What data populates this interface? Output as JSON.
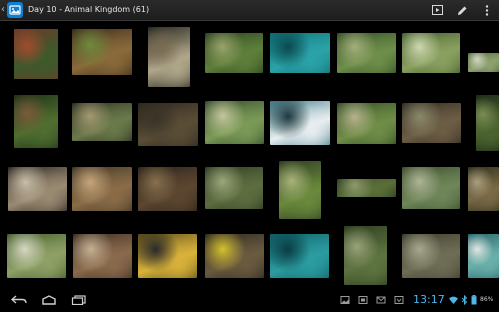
{
  "action_bar": {
    "title": "Day 10 - Animal Kingdom (61)",
    "app_icon": "gallery-app-icon",
    "back_icon": "up-caret-icon",
    "actions": [
      "slideshow-icon",
      "edit-pencil-icon",
      "overflow-menu-icon"
    ]
  },
  "photos": {
    "count_label": "61",
    "thumbnails": [
      {
        "label": "red-rock-tree",
        "colors": [
          "#6b3b2a",
          "#3d5a2b",
          "#a24b2e"
        ]
      },
      {
        "label": "tortoise-in-hollow",
        "colors": [
          "#3a2a1a",
          "#8a6a3a",
          "#6f8a3d"
        ]
      },
      {
        "label": "branch-with-animal",
        "colors": [
          "#2a2a22",
          "#b0a78a",
          "#7a6a52"
        ]
      },
      {
        "label": "jungle-rocks",
        "colors": [
          "#28401e",
          "#5e7f3a",
          "#9aa36a"
        ]
      },
      {
        "label": "fish-aquarium",
        "colors": [
          "#0f6f74",
          "#2aa3a8",
          "#0a4a4f"
        ]
      },
      {
        "label": "forest-grove",
        "colors": [
          "#2e4a20",
          "#6e8e4a",
          "#a3b07c"
        ]
      },
      {
        "label": "savanna-trees",
        "colors": [
          "#3f5a2a",
          "#8aa060",
          "#cfd8b0"
        ]
      },
      {
        "label": "savanna-path",
        "colors": [
          "#4c6a33",
          "#8ea170",
          "#d3d6c6"
        ]
      },
      {
        "label": "jungle-trunk",
        "colors": [
          "#1f3219",
          "#4f6e2f",
          "#7b5a3a"
        ]
      },
      {
        "label": "lizard-on-log",
        "colors": [
          "#2a2a1f",
          "#6a7a4a",
          "#a39a70"
        ]
      },
      {
        "label": "boulder-closeup",
        "colors": [
          "#2b261d",
          "#5a4d36",
          "#3a3428"
        ]
      },
      {
        "label": "lily-pads",
        "colors": [
          "#30482a",
          "#7b9a56",
          "#c4c79c"
        ]
      },
      {
        "label": "swan-on-water",
        "colors": [
          "#3f7c88",
          "#e8eef0",
          "#1e3a40"
        ]
      },
      {
        "label": "garden-path",
        "colors": [
          "#2f4b22",
          "#6f8d47",
          "#b7b28c"
        ]
      },
      {
        "label": "root-stump",
        "colors": [
          "#2f2a20",
          "#6c5d45",
          "#8c8a6a"
        ]
      },
      {
        "label": "dense-bamboo",
        "colors": [
          "#1e2c18",
          "#4c6430",
          "#7c8d54"
        ]
      },
      {
        "label": "figurines",
        "colors": [
          "#2a2520",
          "#9a8a72",
          "#c8bfa8"
        ]
      },
      {
        "label": "iguana-on-stump",
        "colors": [
          "#3d3322",
          "#8a6c48",
          "#c6a67c"
        ]
      },
      {
        "label": "tree-bark",
        "colors": [
          "#2a2219",
          "#5b4630",
          "#87704e"
        ]
      },
      {
        "label": "gorilla-tree",
        "colors": [
          "#2e3a22",
          "#5e6d40",
          "#9aa77a"
        ]
      },
      {
        "label": "fern-branch",
        "colors": [
          "#2f3d22",
          "#6a8a3c",
          "#a9b27a"
        ]
      },
      {
        "label": "big-tree",
        "colors": [
          "#263a1c",
          "#5a6e38",
          "#8f9a6a"
        ]
      },
      {
        "label": "far-lawn",
        "colors": [
          "#3a4a2a",
          "#6e8658",
          "#aeb597"
        ]
      },
      {
        "label": "deer-in-woods",
        "colors": [
          "#30301f",
          "#7a6a46",
          "#a99f7c"
        ]
      },
      {
        "label": "savanna-tree",
        "colors": [
          "#3f5a28",
          "#8fa066",
          "#d6d8c2"
        ]
      },
      {
        "label": "shop-shelf",
        "colors": [
          "#3a2c22",
          "#8a6a4c",
          "#c6b092"
        ]
      },
      {
        "label": "yellow-drum",
        "colors": [
          "#5a4a1a",
          "#d8b23a",
          "#2a2a2a"
        ]
      },
      {
        "label": "yellow-bird-ground",
        "colors": [
          "#2a2620",
          "#6a5a40",
          "#d4c030"
        ]
      },
      {
        "label": "fish-tank-2",
        "colors": [
          "#0e5f66",
          "#2b9ca0",
          "#0a3d44"
        ]
      },
      {
        "label": "forest-trees",
        "colors": [
          "#2d3e1f",
          "#5e7440",
          "#9aa27a"
        ]
      },
      {
        "label": "rock-wall",
        "colors": [
          "#3a3a2c",
          "#6e6e56",
          "#a9a88e"
        ]
      },
      {
        "label": "water-pool",
        "colors": [
          "#2b6a6e",
          "#6ab0aa",
          "#e0e6e2"
        ]
      },
      {
        "label": "savanna-acacia",
        "colors": [
          "#3c5628",
          "#8ea068",
          "#d8d9c2"
        ]
      }
    ]
  },
  "nav_bar": {
    "buttons": [
      "back-icon",
      "home-icon",
      "recent-apps-icon"
    ],
    "clock": "13:17",
    "battery": "86%",
    "status_icons": [
      "gallery-notification-icon",
      "screenshot-notification-icon",
      "mail-notification-icon",
      "download-notification-icon",
      "wifi-icon",
      "bluetooth-icon",
      "battery-icon"
    ]
  }
}
